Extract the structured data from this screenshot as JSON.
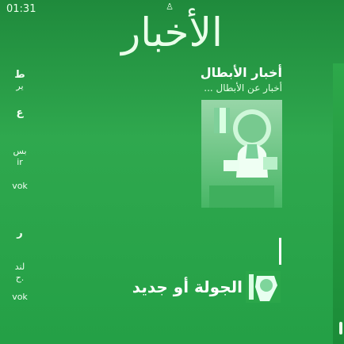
{
  "status": {
    "time": "01:31"
  },
  "header": {
    "title": "الأخبار",
    "person_glyph": "♙"
  },
  "sidebar": {
    "items": [
      {
        "top": "ط",
        "bottom": "ير"
      },
      {
        "top": "ع",
        "bottom": ""
      },
      {
        "top": "بس",
        "bottom": "ir"
      },
      {
        "top": "vok",
        "bottom": ""
      },
      {
        "top": "ر",
        "bottom": ""
      },
      {
        "top": "لند",
        "bottom": "ح."
      },
      {
        "top": "vok",
        "bottom": ""
      }
    ]
  },
  "feed": {
    "title": "أخبار الأبطال",
    "subtitle": "أخبار عن الأبطال ...",
    "bottom_caption": "الجولة أو جديد"
  },
  "colors": {
    "accent": "#2fa84e",
    "text": "#ffffff"
  },
  "icons": {
    "person": "person-icon"
  }
}
